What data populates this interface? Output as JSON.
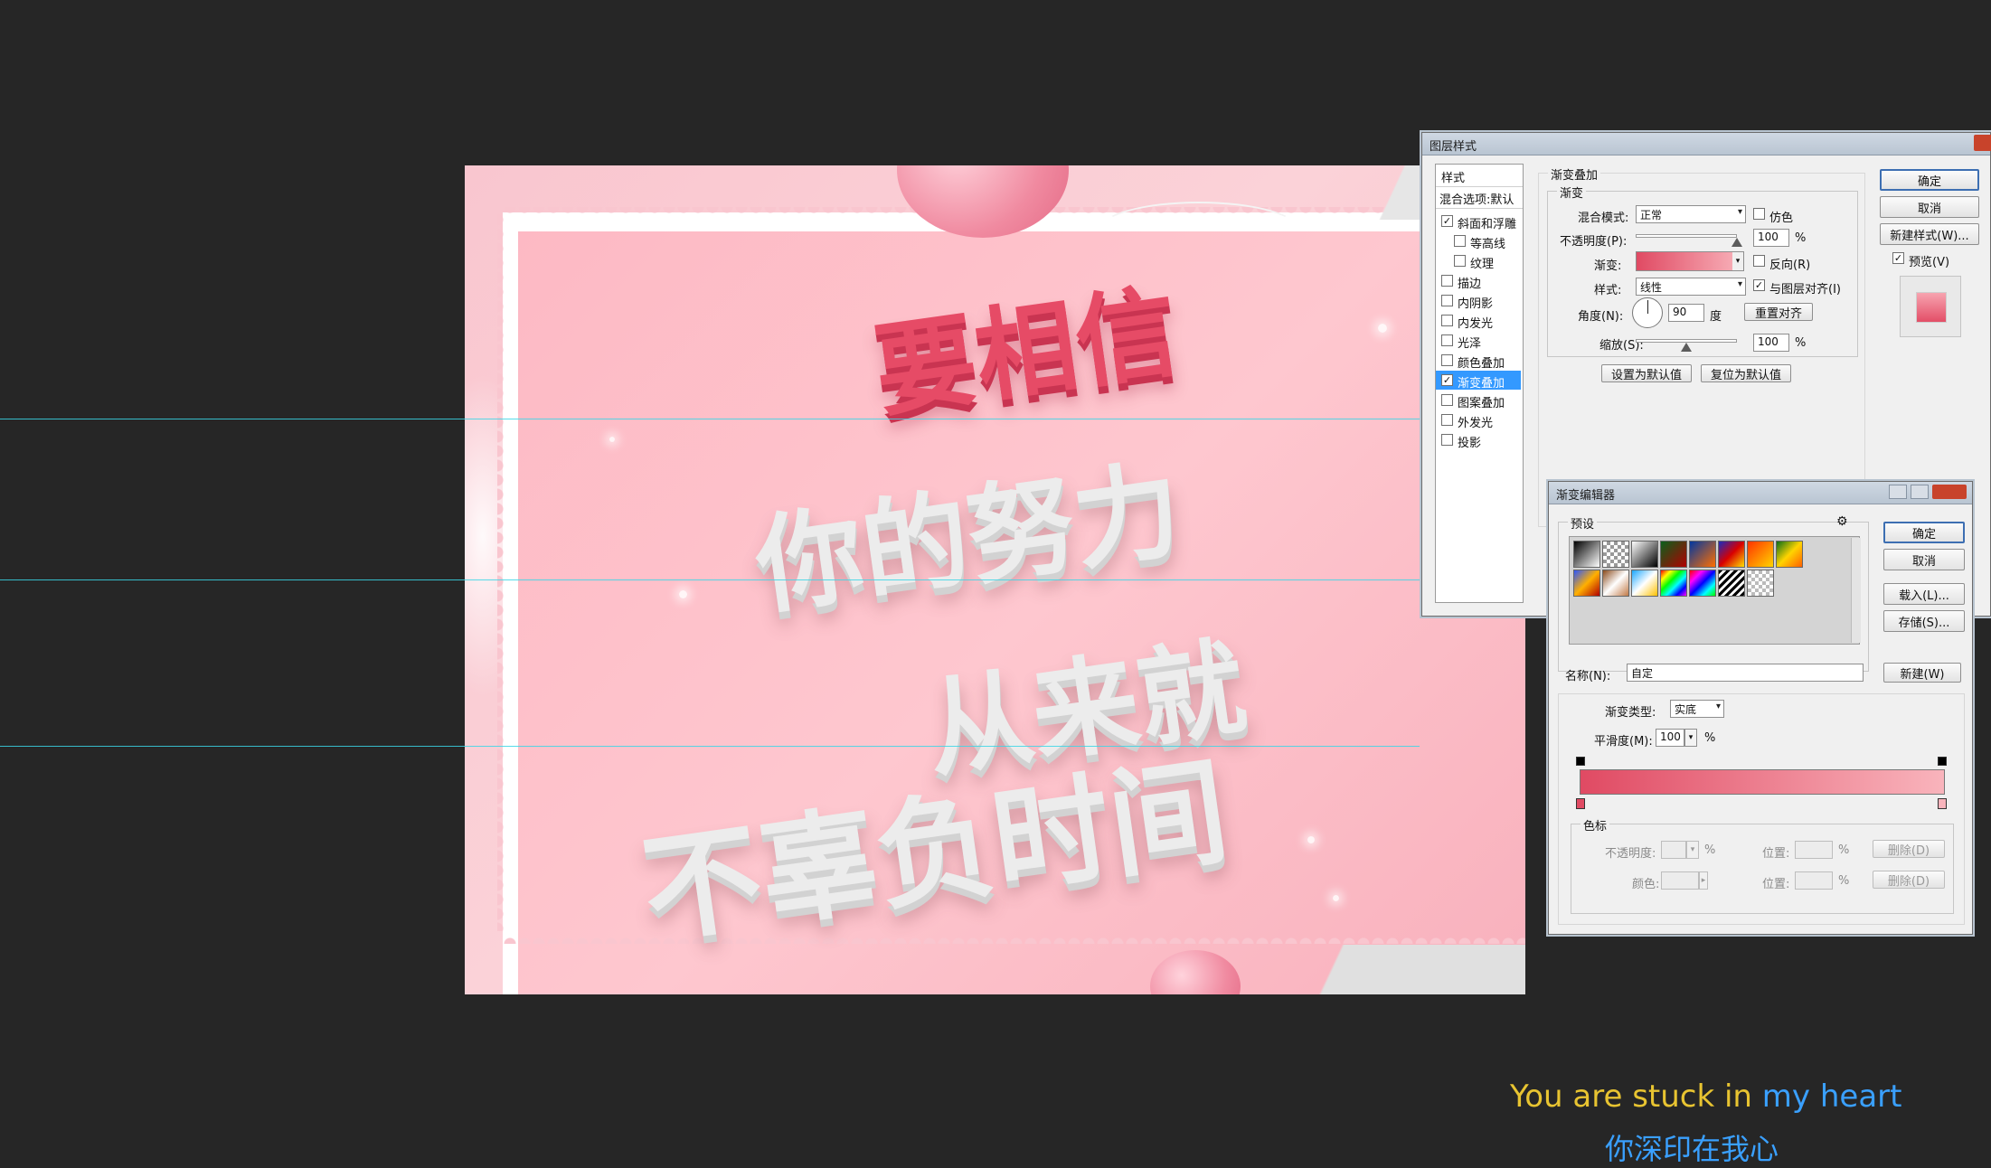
{
  "canvas": {
    "lines": [
      "要相信",
      "你的努力",
      "从来就",
      "不辜负时间"
    ]
  },
  "layer_style": {
    "title": "图层样式",
    "list_header": "样式",
    "blend_default": "混合选项:默认",
    "items": [
      {
        "label": "斜面和浮雕",
        "checked": true,
        "selected": false
      },
      {
        "label": "等高线",
        "checked": false,
        "selected": false
      },
      {
        "label": "纹理",
        "checked": false,
        "selected": false
      },
      {
        "label": "描边",
        "checked": false,
        "selected": false
      },
      {
        "label": "内阴影",
        "checked": false,
        "selected": false
      },
      {
        "label": "内发光",
        "checked": false,
        "selected": false
      },
      {
        "label": "光泽",
        "checked": false,
        "selected": false
      },
      {
        "label": "颜色叠加",
        "checked": false,
        "selected": false
      },
      {
        "label": "渐变叠加",
        "checked": true,
        "selected": true
      },
      {
        "label": "图案叠加",
        "checked": false,
        "selected": false
      },
      {
        "label": "外发光",
        "checked": false,
        "selected": false
      },
      {
        "label": "投影",
        "checked": false,
        "selected": false
      }
    ],
    "section_title": "渐变叠加",
    "group_title": "渐变",
    "blend_mode_label": "混合模式:",
    "blend_mode_value": "正常",
    "dither_label": "仿色",
    "dither_checked": false,
    "opacity_label": "不透明度(P):",
    "opacity_value": "100",
    "percent": "%",
    "opacity_fraction": 1.0,
    "gradient_label": "渐变:",
    "reverse_label": "反向(R)",
    "reverse_checked": false,
    "style_label": "样式:",
    "style_value": "线性",
    "align_label": "与图层对齐(I)",
    "align_checked": true,
    "angle_label": "角度(N):",
    "angle_value": "90",
    "angle_unit": "度",
    "reset_align_btn": "重置对齐",
    "scale_label": "缩放(S):",
    "scale_value": "100",
    "scale_fraction": 0.5,
    "set_default_btn": "设置为默认值",
    "reset_default_btn": "复位为默认值",
    "ok_btn": "确定",
    "cancel_btn": "取消",
    "new_style_btn": "新建样式(W)...",
    "preview_label": "预览(V)",
    "preview_checked": true
  },
  "gradient_editor": {
    "title": "渐变编辑器",
    "presets_label": "预设",
    "gear_icon": "gear-icon",
    "ok_btn": "确定",
    "cancel_btn": "取消",
    "load_btn": "载入(L)...",
    "save_btn": "存储(S)...",
    "name_label": "名称(N):",
    "name_value": "自定",
    "new_btn": "新建(W)",
    "type_label": "渐变类型:",
    "type_value": "实底",
    "smooth_label": "平滑度(M):",
    "smooth_value": "100",
    "percent": "%",
    "stops_group": "色标",
    "stop_opacity_label": "不透明度:",
    "stop_color_label": "颜色:",
    "location_label": "位置:",
    "delete_btn": "删除(D)",
    "gradient_from": "#e04a63",
    "gradient_to": "#f9b4bc"
  },
  "subtitles": {
    "en_part1": "You are stuck in ",
    "en_part2": "my heart",
    "zh": "你深印在我心"
  }
}
